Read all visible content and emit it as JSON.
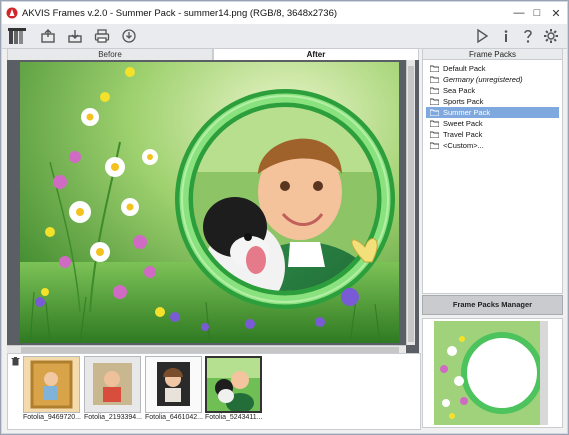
{
  "window": {
    "title": "AKVIS Frames v.2.0 - Summer Pack - summer14.png (RGB/8, 3648x2736)",
    "controls": {
      "minimize": "—",
      "maximize": "□",
      "close": "✕"
    }
  },
  "toolbar": {
    "left_icons": [
      "frames-logo-icon",
      "open-icon",
      "save-icon",
      "print-icon",
      "share-icon"
    ],
    "right_icons": [
      "play-icon",
      "info-icon",
      "help-icon",
      "settings-icon"
    ]
  },
  "view_tabs": [
    {
      "label": "Before",
      "active": false
    },
    {
      "label": "After",
      "active": true
    }
  ],
  "right_panel": {
    "header": "Frame Packs",
    "packs": [
      {
        "label": "Default Pack",
        "selected": false,
        "italic": false
      },
      {
        "label": "Germany (unregistered)",
        "selected": false,
        "italic": true
      },
      {
        "label": "Sea Pack",
        "selected": false,
        "italic": false
      },
      {
        "label": "Sports Pack",
        "selected": false,
        "italic": false
      },
      {
        "label": "Summer Pack",
        "selected": true,
        "italic": false
      },
      {
        "label": "Sweet Pack",
        "selected": false,
        "italic": false
      },
      {
        "label": "Travel Pack",
        "selected": false,
        "italic": false
      },
      {
        "label": "<Custom>...",
        "selected": false,
        "italic": false
      }
    ],
    "manager_button": "Frame Packs Manager"
  },
  "filmstrip": {
    "items": [
      {
        "label": "Fotolia_9469720...",
        "selected": false
      },
      {
        "label": "Fotolia_2193394...",
        "selected": false
      },
      {
        "label": "Fotolia_6461042...",
        "selected": false
      },
      {
        "label": "Fotolia_5243411...",
        "selected": true
      }
    ]
  },
  "colors": {
    "accent_selection": "#7fa8de",
    "frame_green": "#49c25a",
    "canvas_bg": "#5a5f66"
  }
}
